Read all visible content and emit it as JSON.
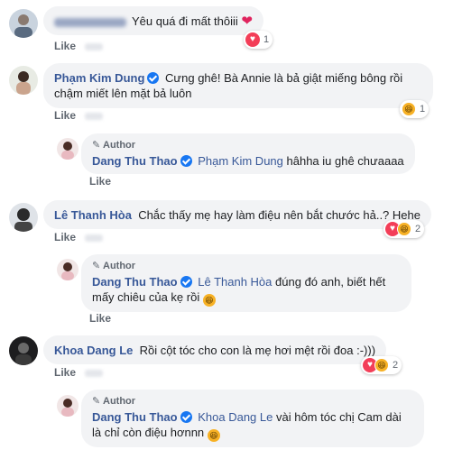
{
  "labels": {
    "like": "Like",
    "author": "Author"
  },
  "comments": [
    {
      "name": "",
      "text": "Yêu quá đi mất thôiii",
      "reaction_count": "1",
      "reaction_types": [
        "heart-icon"
      ]
    },
    {
      "name": "Phạm Kim Dung",
      "verified": true,
      "text": "Cưng ghê! Bà Annie là bả giật miếng bông rồi chậm miết lên mặt bả luôn",
      "reaction_count": "1",
      "reaction_types": [
        "haha-icon"
      ],
      "reply": {
        "name": "Dang Thu Thao",
        "verified": true,
        "tag": "Phạm Kim Dung",
        "text": "hâhha iu ghê chưaaaa"
      }
    },
    {
      "name": "Lê Thanh Hòa",
      "text": "Chắc thấy mẹ hay làm điệu nên bắt chước hả..? Hehe",
      "reaction_count": "2",
      "reaction_types": [
        "heart-icon",
        "haha-icon"
      ],
      "reply": {
        "name": "Dang Thu Thao",
        "verified": true,
        "tag": "Lê Thanh Hòa",
        "text": "đúng đó anh, biết hết mấy chiêu của kẹ rồi"
      }
    },
    {
      "name": "Khoa Dang Le",
      "text": "Rồi cột tóc cho con là mẹ hơi mệt rồi đoa :-)))",
      "reaction_count": "2",
      "reaction_types": [
        "heart-icon",
        "haha-icon"
      ],
      "reply": {
        "name": "Dang Thu Thao",
        "verified": true,
        "tag": "Khoa Dang Le",
        "text": "vài hôm tóc chị Cam dài là chỉ còn điệu hơnnn"
      }
    }
  ]
}
